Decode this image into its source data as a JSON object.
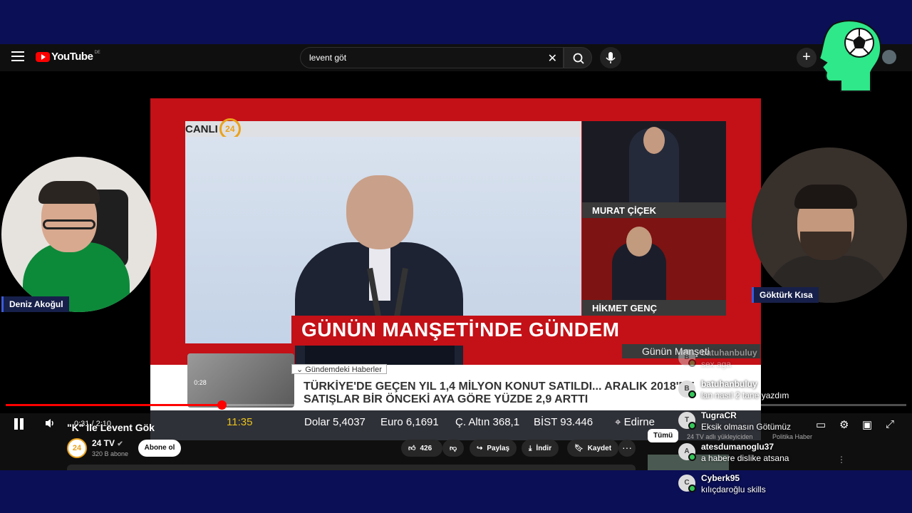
{
  "youtube": {
    "logo_text": "YouTube",
    "logo_region": "DE",
    "search_value": "levent göt",
    "clear_glyph": "✕",
    "create_glyph": "+"
  },
  "video": {
    "tv": {
      "canli_label": "CANLI",
      "channel_num": "24",
      "host1_name": "MURAT ÇİÇEK",
      "host2_name": "HİKMET GENÇ",
      "headline": "GÜNÜN MANŞETİ'NDE GÜNDEM",
      "program": "Günün Manşeti",
      "ticker_tag": "Gündemdeki Haberler",
      "ticker_line1": "TÜRKİYE'DE GEÇEN YIL 1,4 MİLYON KONUT SATILDI... ARALIK 2018'DE",
      "ticker_line2": "SATIŞLAR BİR ÖNCEKİ AYA GÖRE YÜZDE 2,9 ARTTI",
      "time": "11:35",
      "dolar": "Dolar 5,4037",
      "euro": "Euro 6,1691",
      "altin": "Ç. Altın 368,1",
      "bist": "BİST 93.446",
      "city": "Edirne"
    },
    "progress_fraction": 0.24,
    "preview_time": "0:28",
    "time_display": "0:31 / 2:10"
  },
  "info": {
    "title": "\"K\" ile Levent Gök",
    "channel_logo": "24",
    "channel_name": "24 TV",
    "subs": "320 B abone",
    "subscribe": "Abone ol",
    "likes": "426",
    "share": "Paylaş",
    "download": "İndir",
    "save": "Kaydet",
    "more": "···"
  },
  "recommend": {
    "all_chip": "Tümü",
    "chip2": "24 TV adlı yükleyiciden",
    "chip3": "Politika Haber"
  },
  "streamers": {
    "left_name": "Deniz Akoğul",
    "right_name": "Göktürk Kısa"
  },
  "chat": [
    {
      "initial": "B",
      "user": "batuhanbuluy",
      "text": "sex aga",
      "faded": true
    },
    {
      "initial": "B",
      "user": "batuhanbuluy",
      "text": "lan nasıl 2 tane yazdım"
    },
    {
      "initial": "T",
      "user": "TugraCR",
      "text": "Eksik olmasın Götümüz"
    },
    {
      "initial": "A",
      "user": "atesdumanoglu37",
      "text": "a habere dislike atsana"
    },
    {
      "initial": "C",
      "user": "Cyberk95",
      "text": "kılıçdaroğlu skills"
    }
  ]
}
